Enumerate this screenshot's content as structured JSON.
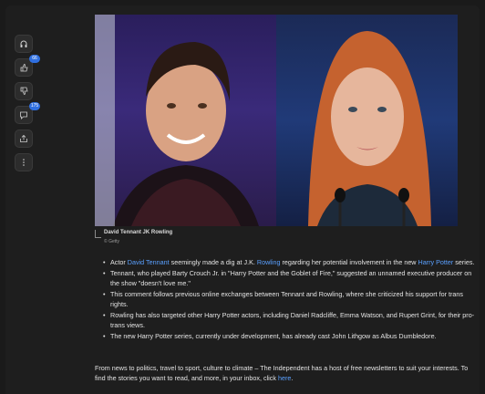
{
  "rail": {
    "items": [
      {
        "icon": "headphones-icon",
        "badge": ""
      },
      {
        "icon": "thumbs-up-icon",
        "badge": "66"
      },
      {
        "icon": "thumbs-down-icon",
        "badge": ""
      },
      {
        "icon": "comment-icon",
        "badge": "175"
      },
      {
        "icon": "share-icon",
        "badge": ""
      },
      {
        "icon": "more-icon",
        "badge": ""
      }
    ]
  },
  "image": {
    "caption": "David Tennant JK Rowling",
    "credit": "© Getty"
  },
  "points": [
    {
      "pre": "Actor ",
      "link1": "David Tennant",
      "mid": " seemingly made a dig at J.K. ",
      "link2": "Rowling",
      "mid2": " regarding her potential involvement in the new ",
      "link3": "Harry Potter",
      "post": " series."
    },
    {
      "text": "Tennant, who played Barty Crouch Jr. in \"Harry Potter and the Goblet of Fire,\" suggested an unnamed executive producer on the show \"doesn't love me.\""
    },
    {
      "text": "This comment follows previous online exchanges between Tennant and Rowling, where she criticized his support for trans rights."
    },
    {
      "text": "Rowling has also targeted other Harry Potter actors, including Daniel Radcliffe, Emma Watson, and Rupert Grint, for their pro-trans views."
    },
    {
      "text": "The new Harry Potter series, currently under development, has already cast John Lithgow as Albus Dumbledore."
    }
  ],
  "closing": {
    "text": "From news to politics, travel to sport, culture to climate – The Independent has a host of free newsletters to suit your interests. To find the stories you want to read, and more, in your inbox, click ",
    "link": "here",
    "end": "."
  }
}
